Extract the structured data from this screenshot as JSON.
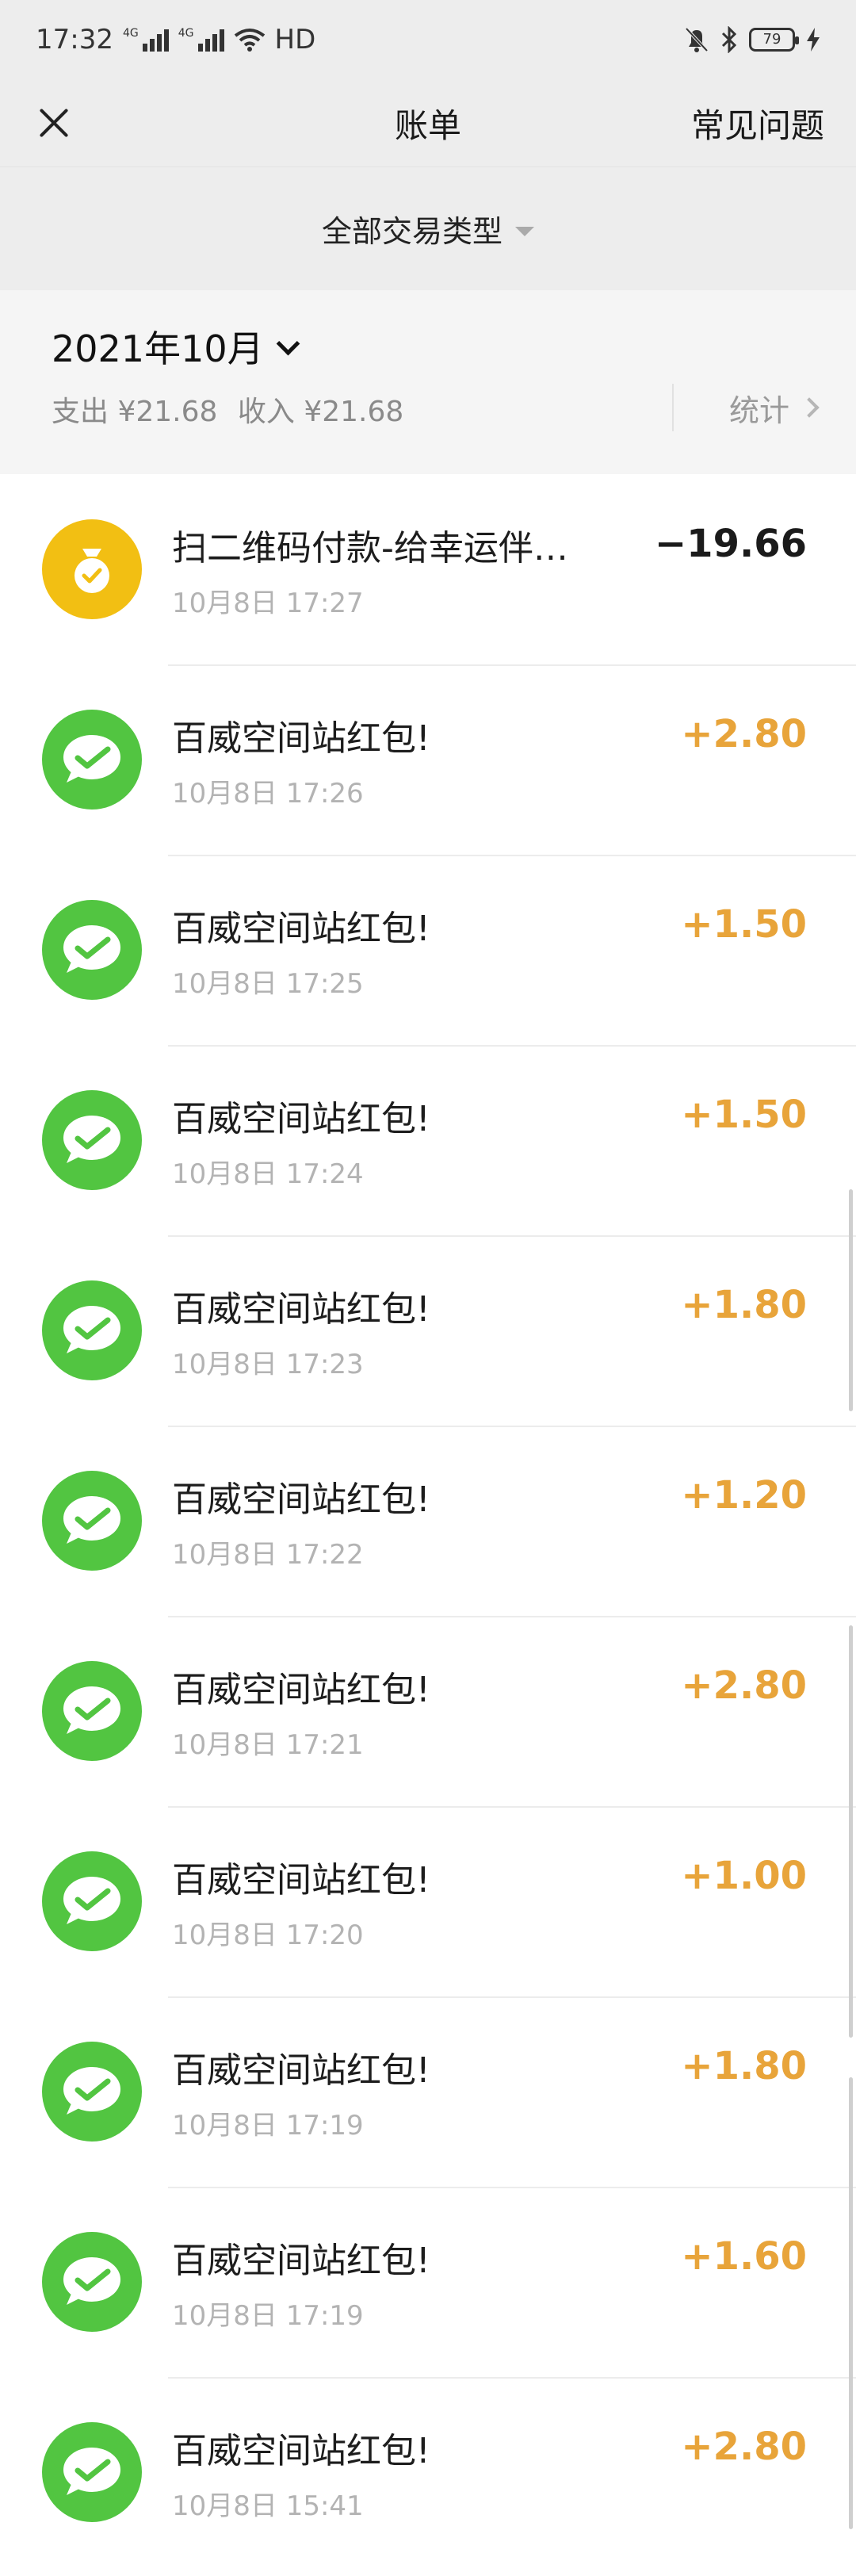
{
  "status_bar": {
    "time": "17:32",
    "network": [
      "4G",
      "4G"
    ],
    "hd": "HD",
    "battery": "79"
  },
  "nav": {
    "title": "账单",
    "right_link": "常见问题"
  },
  "filter": {
    "label": "全部交易类型"
  },
  "month_header": {
    "month": "2021年10月",
    "expense": "支出 ¥21.68",
    "income": "收入 ¥21.68",
    "stats_label": "统计"
  },
  "colors": {
    "positive": "#e8a43a",
    "negative": "#1b1b1b",
    "pay_icon_bg": "#f2bf13",
    "redpacket_icon_bg": "#52c541"
  },
  "transactions": [
    {
      "icon": "payment-pouch-icon",
      "title": "扫二维码付款-给幸运伴…",
      "time": "10月8日 17:27",
      "amount": "−19.66",
      "kind": "negative"
    },
    {
      "icon": "wechat-chat-icon",
      "title": "百威空间站红包!",
      "time": "10月8日 17:26",
      "amount": "+2.80",
      "kind": "positive"
    },
    {
      "icon": "wechat-chat-icon",
      "title": "百威空间站红包!",
      "time": "10月8日 17:25",
      "amount": "+1.50",
      "kind": "positive"
    },
    {
      "icon": "wechat-chat-icon",
      "title": "百威空间站红包!",
      "time": "10月8日 17:24",
      "amount": "+1.50",
      "kind": "positive"
    },
    {
      "icon": "wechat-chat-icon",
      "title": "百威空间站红包!",
      "time": "10月8日 17:23",
      "amount": "+1.80",
      "kind": "positive"
    },
    {
      "icon": "wechat-chat-icon",
      "title": "百威空间站红包!",
      "time": "10月8日 17:22",
      "amount": "+1.20",
      "kind": "positive"
    },
    {
      "icon": "wechat-chat-icon",
      "title": "百威空间站红包!",
      "time": "10月8日 17:21",
      "amount": "+2.80",
      "kind": "positive"
    },
    {
      "icon": "wechat-chat-icon",
      "title": "百威空间站红包!",
      "time": "10月8日 17:20",
      "amount": "+1.00",
      "kind": "positive"
    },
    {
      "icon": "wechat-chat-icon",
      "title": "百威空间站红包!",
      "time": "10月8日 17:19",
      "amount": "+1.80",
      "kind": "positive"
    },
    {
      "icon": "wechat-chat-icon",
      "title": "百威空间站红包!",
      "time": "10月8日 17:19",
      "amount": "+1.60",
      "kind": "positive"
    },
    {
      "icon": "wechat-chat-icon",
      "title": "百威空间站红包!",
      "time": "10月8日 15:41",
      "amount": "+2.80",
      "kind": "positive"
    }
  ]
}
